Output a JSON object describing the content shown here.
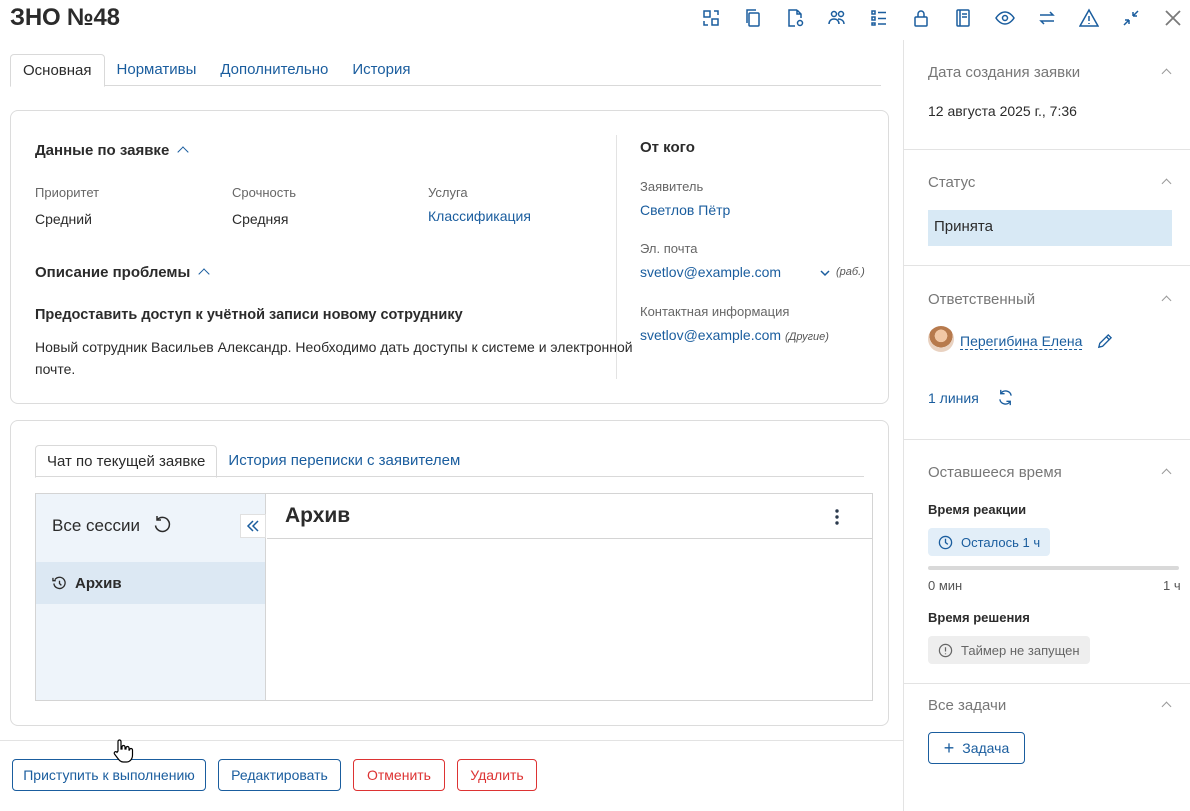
{
  "header": {
    "title": "ЗНО №48"
  },
  "toolbar": {
    "icons": [
      "convert-icon",
      "copy-icon",
      "document-settings-icon",
      "users-icon",
      "checklist-icon",
      "lock-icon",
      "book-icon",
      "eye-icon",
      "swap-icon",
      "warning-icon",
      "minimize-icon",
      "close-icon"
    ]
  },
  "tabs": [
    "Основная",
    "Нормативы",
    "Дополнительно",
    "История"
  ],
  "request": {
    "section_title": "Данные по заявке",
    "priority_label": "Приоритет",
    "priority_value": "Средний",
    "urgency_label": "Срочность",
    "urgency_value": "Средняя",
    "service_label": "Услуга",
    "service_value": "Классификация"
  },
  "problem": {
    "section_title": "Описание проблемы",
    "subject": "Предоставить доступ к учётной записи новому сотруднику",
    "text_line1": "Новый сотрудник Васильев Александр. Необходимо дать доступы к системе и электронной",
    "text_line2": "почте."
  },
  "from": {
    "section_title": "От кого",
    "applicant_label": "Заявитель",
    "applicant_value": "Светлов Пётр",
    "email_label": "Эл. почта",
    "email_value": "svetlov@example.com",
    "email_note": "(раб.)",
    "contact_label": "Контактная информация",
    "contact_value": "svetlov@example.com",
    "contact_note": "(Другие)"
  },
  "chat": {
    "tabs": [
      "Чат по текущей заявке",
      "История переписки с заявителем"
    ],
    "sessions_title": "Все сессии",
    "session_item": "Архив",
    "panel_title": "Архив"
  },
  "footer": {
    "start": "Приступить к выполнению",
    "edit": "Редактировать",
    "cancel": "Отменить",
    "delete": "Удалить"
  },
  "sidebar": {
    "created_label": "Дата создания заявки",
    "created_value": "12 августа 2025 г., 7:36",
    "status_label": "Статус",
    "status_value": "Принята",
    "assignee_label": "Ответственный",
    "assignee_value": "Перегибина Елена",
    "line_value": "1 линия",
    "remaining_label": "Оставшееся время",
    "reaction_label": "Время реакции",
    "reaction_pill": "Осталось 1 ч",
    "reaction_progress": 0,
    "scale_min": "0 мин",
    "scale_max": "1 ч",
    "resolution_label": "Время решения",
    "resolution_pill": "Таймер не запущен",
    "tasks_label": "Все задачи",
    "task_button": "Задача"
  },
  "colors": {
    "accent": "#1a5d9e",
    "danger": "#dd3333",
    "status_bg": "#d8e9f5"
  }
}
